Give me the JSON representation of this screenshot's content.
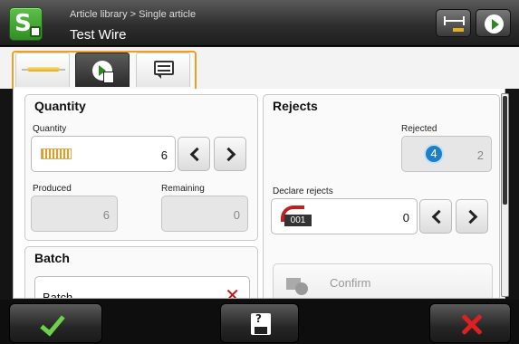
{
  "header": {
    "breadcrumb": "Article library > Single article",
    "title": "Test Wire",
    "icons": {
      "app": "app-logo-icon",
      "width": "wire-width-icon",
      "next": "next-arrow-icon"
    }
  },
  "tabs": [
    {
      "icon": "wire-icon",
      "active": false
    },
    {
      "icon": "process-icon",
      "active": true
    },
    {
      "icon": "message-icon",
      "active": false
    }
  ],
  "quantity": {
    "title": "Quantity",
    "quantity_label": "Quantity",
    "quantity_value": "6",
    "produced_label": "Produced",
    "produced_value": "6",
    "remaining_label": "Remaining",
    "remaining_value": "0"
  },
  "batch": {
    "title": "Batch",
    "field_label": "Batch"
  },
  "rejects": {
    "title": "Rejects",
    "rejected_label": "Rejected",
    "badge": "4",
    "rejected_value": "2",
    "declare_label": "Declare rejects",
    "declare_icon_text": "001",
    "declare_value": "0",
    "confirm_label": "Confirm"
  },
  "footer": {
    "ok": "ok-check-icon",
    "save": "save-icon",
    "cancel": "cancel-x-icon"
  },
  "colors": {
    "accent": "#f0a020",
    "ok": "#6fd04a",
    "cancel": "#e02020",
    "badge": "#1e7fc8"
  }
}
